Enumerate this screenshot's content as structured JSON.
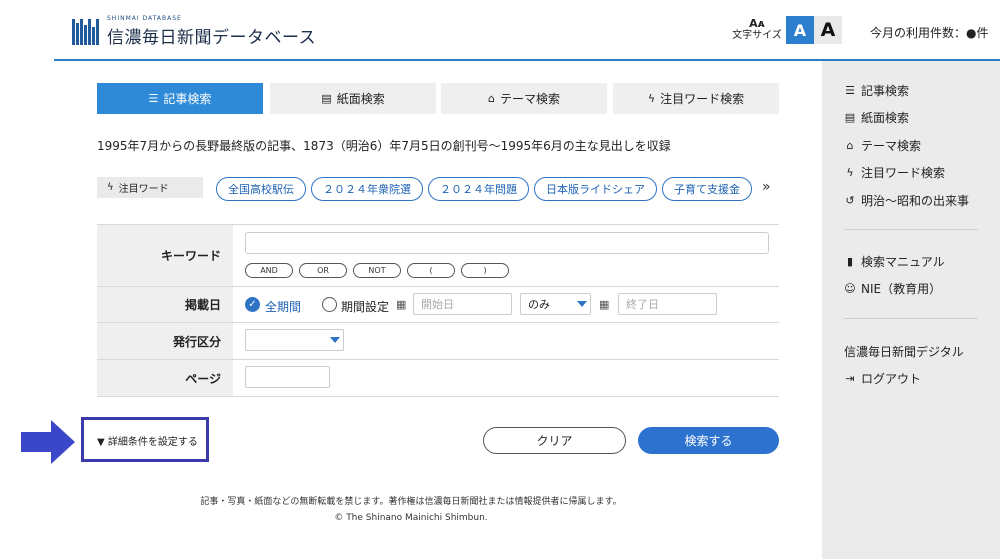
{
  "header": {
    "logo_sub": "SHINMAI DATABASE",
    "logo_main": "信濃毎日新聞データベース",
    "font_size_label": "文字サイズ",
    "font_size_icon": "Aᴀ",
    "font_small": "A",
    "font_large": "A",
    "usage": "今月の利用件数：●件"
  },
  "tabs": [
    {
      "label": "記事検索",
      "icon": "list-icon"
    },
    {
      "label": "紙面検索",
      "icon": "newspaper-icon"
    },
    {
      "label": "テーマ検索",
      "icon": "bookmark-icon"
    },
    {
      "label": "注目ワード検索",
      "icon": "bolt-icon"
    }
  ],
  "description": "1995年7月からの長野最終版の記事、1873（明治6）年7月5日の創刊号〜1995年6月の主な見出しを収録",
  "keywords": {
    "label": "注目ワード",
    "items": [
      "全国高校駅伝",
      "２０２４年衆院選",
      "２０２４年問題",
      "日本版ライドシェア",
      "子育て支援金"
    ],
    "more": "»"
  },
  "form": {
    "keyword_label": "キーワード",
    "operators": [
      "AND",
      "OR",
      "NOT",
      "(",
      ")"
    ],
    "date_label": "掲載日",
    "all_period": "全期間",
    "set_period": "期間設定",
    "start_placeholder": "開始日",
    "range_option": "のみ",
    "end_placeholder": "終了日",
    "edition_label": "発行区分",
    "edition_value": "",
    "page_label": "ページ"
  },
  "actions": {
    "detail": "▼ 詳細条件を設定する",
    "clear": "クリア",
    "search": "検索する"
  },
  "sidebar": {
    "items": [
      {
        "label": "記事検索",
        "icon": "list-icon"
      },
      {
        "label": "紙面検索",
        "icon": "newspaper-icon"
      },
      {
        "label": "テーマ検索",
        "icon": "bookmark-icon"
      },
      {
        "label": "注目ワード検索",
        "icon": "bolt-icon"
      },
      {
        "label": "明治〜昭和の出来事",
        "icon": "history-icon"
      },
      {
        "label": "検索マニュアル",
        "icon": "book-icon"
      },
      {
        "label": "NIE（教育用）",
        "icon": "smile-icon"
      },
      {
        "label": "信濃毎日新聞デジタル",
        "icon": ""
      },
      {
        "label": "ログアウト",
        "icon": "logout-icon"
      }
    ]
  },
  "footer": {
    "notice": "記事・写真・紙面などの無断転載を禁じます。著作権は信濃毎日新聞社または情報提供者に帰属します。",
    "copyright": "© The Shinano Mainichi Shimbun."
  },
  "colors": {
    "accent": "#2e8ad6",
    "button": "#2e72cf",
    "sidebar_bg": "#ebebeb",
    "highlight_box": "#3a3aaa"
  }
}
